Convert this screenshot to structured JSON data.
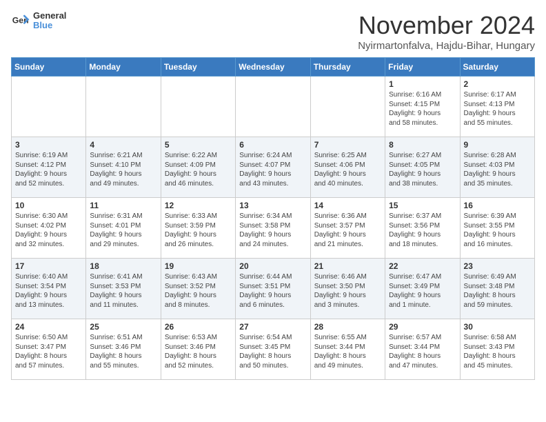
{
  "logo": {
    "line1": "General",
    "line2": "Blue"
  },
  "title": "November 2024",
  "location": "Nyirmartonfalva, Hajdu-Bihar, Hungary",
  "weekdays": [
    "Sunday",
    "Monday",
    "Tuesday",
    "Wednesday",
    "Thursday",
    "Friday",
    "Saturday"
  ],
  "weeks": [
    [
      {
        "day": "",
        "content": ""
      },
      {
        "day": "",
        "content": ""
      },
      {
        "day": "",
        "content": ""
      },
      {
        "day": "",
        "content": ""
      },
      {
        "day": "",
        "content": ""
      },
      {
        "day": "1",
        "content": "Sunrise: 6:16 AM\nSunset: 4:15 PM\nDaylight: 9 hours\nand 58 minutes."
      },
      {
        "day": "2",
        "content": "Sunrise: 6:17 AM\nSunset: 4:13 PM\nDaylight: 9 hours\nand 55 minutes."
      }
    ],
    [
      {
        "day": "3",
        "content": "Sunrise: 6:19 AM\nSunset: 4:12 PM\nDaylight: 9 hours\nand 52 minutes."
      },
      {
        "day": "4",
        "content": "Sunrise: 6:21 AM\nSunset: 4:10 PM\nDaylight: 9 hours\nand 49 minutes."
      },
      {
        "day": "5",
        "content": "Sunrise: 6:22 AM\nSunset: 4:09 PM\nDaylight: 9 hours\nand 46 minutes."
      },
      {
        "day": "6",
        "content": "Sunrise: 6:24 AM\nSunset: 4:07 PM\nDaylight: 9 hours\nand 43 minutes."
      },
      {
        "day": "7",
        "content": "Sunrise: 6:25 AM\nSunset: 4:06 PM\nDaylight: 9 hours\nand 40 minutes."
      },
      {
        "day": "8",
        "content": "Sunrise: 6:27 AM\nSunset: 4:05 PM\nDaylight: 9 hours\nand 38 minutes."
      },
      {
        "day": "9",
        "content": "Sunrise: 6:28 AM\nSunset: 4:03 PM\nDaylight: 9 hours\nand 35 minutes."
      }
    ],
    [
      {
        "day": "10",
        "content": "Sunrise: 6:30 AM\nSunset: 4:02 PM\nDaylight: 9 hours\nand 32 minutes."
      },
      {
        "day": "11",
        "content": "Sunrise: 6:31 AM\nSunset: 4:01 PM\nDaylight: 9 hours\nand 29 minutes."
      },
      {
        "day": "12",
        "content": "Sunrise: 6:33 AM\nSunset: 3:59 PM\nDaylight: 9 hours\nand 26 minutes."
      },
      {
        "day": "13",
        "content": "Sunrise: 6:34 AM\nSunset: 3:58 PM\nDaylight: 9 hours\nand 24 minutes."
      },
      {
        "day": "14",
        "content": "Sunrise: 6:36 AM\nSunset: 3:57 PM\nDaylight: 9 hours\nand 21 minutes."
      },
      {
        "day": "15",
        "content": "Sunrise: 6:37 AM\nSunset: 3:56 PM\nDaylight: 9 hours\nand 18 minutes."
      },
      {
        "day": "16",
        "content": "Sunrise: 6:39 AM\nSunset: 3:55 PM\nDaylight: 9 hours\nand 16 minutes."
      }
    ],
    [
      {
        "day": "17",
        "content": "Sunrise: 6:40 AM\nSunset: 3:54 PM\nDaylight: 9 hours\nand 13 minutes."
      },
      {
        "day": "18",
        "content": "Sunrise: 6:41 AM\nSunset: 3:53 PM\nDaylight: 9 hours\nand 11 minutes."
      },
      {
        "day": "19",
        "content": "Sunrise: 6:43 AM\nSunset: 3:52 PM\nDaylight: 9 hours\nand 8 minutes."
      },
      {
        "day": "20",
        "content": "Sunrise: 6:44 AM\nSunset: 3:51 PM\nDaylight: 9 hours\nand 6 minutes."
      },
      {
        "day": "21",
        "content": "Sunrise: 6:46 AM\nSunset: 3:50 PM\nDaylight: 9 hours\nand 3 minutes."
      },
      {
        "day": "22",
        "content": "Sunrise: 6:47 AM\nSunset: 3:49 PM\nDaylight: 9 hours\nand 1 minute."
      },
      {
        "day": "23",
        "content": "Sunrise: 6:49 AM\nSunset: 3:48 PM\nDaylight: 8 hours\nand 59 minutes."
      }
    ],
    [
      {
        "day": "24",
        "content": "Sunrise: 6:50 AM\nSunset: 3:47 PM\nDaylight: 8 hours\nand 57 minutes."
      },
      {
        "day": "25",
        "content": "Sunrise: 6:51 AM\nSunset: 3:46 PM\nDaylight: 8 hours\nand 55 minutes."
      },
      {
        "day": "26",
        "content": "Sunrise: 6:53 AM\nSunset: 3:46 PM\nDaylight: 8 hours\nand 52 minutes."
      },
      {
        "day": "27",
        "content": "Sunrise: 6:54 AM\nSunset: 3:45 PM\nDaylight: 8 hours\nand 50 minutes."
      },
      {
        "day": "28",
        "content": "Sunrise: 6:55 AM\nSunset: 3:44 PM\nDaylight: 8 hours\nand 49 minutes."
      },
      {
        "day": "29",
        "content": "Sunrise: 6:57 AM\nSunset: 3:44 PM\nDaylight: 8 hours\nand 47 minutes."
      },
      {
        "day": "30",
        "content": "Sunrise: 6:58 AM\nSunset: 3:43 PM\nDaylight: 8 hours\nand 45 minutes."
      }
    ]
  ]
}
